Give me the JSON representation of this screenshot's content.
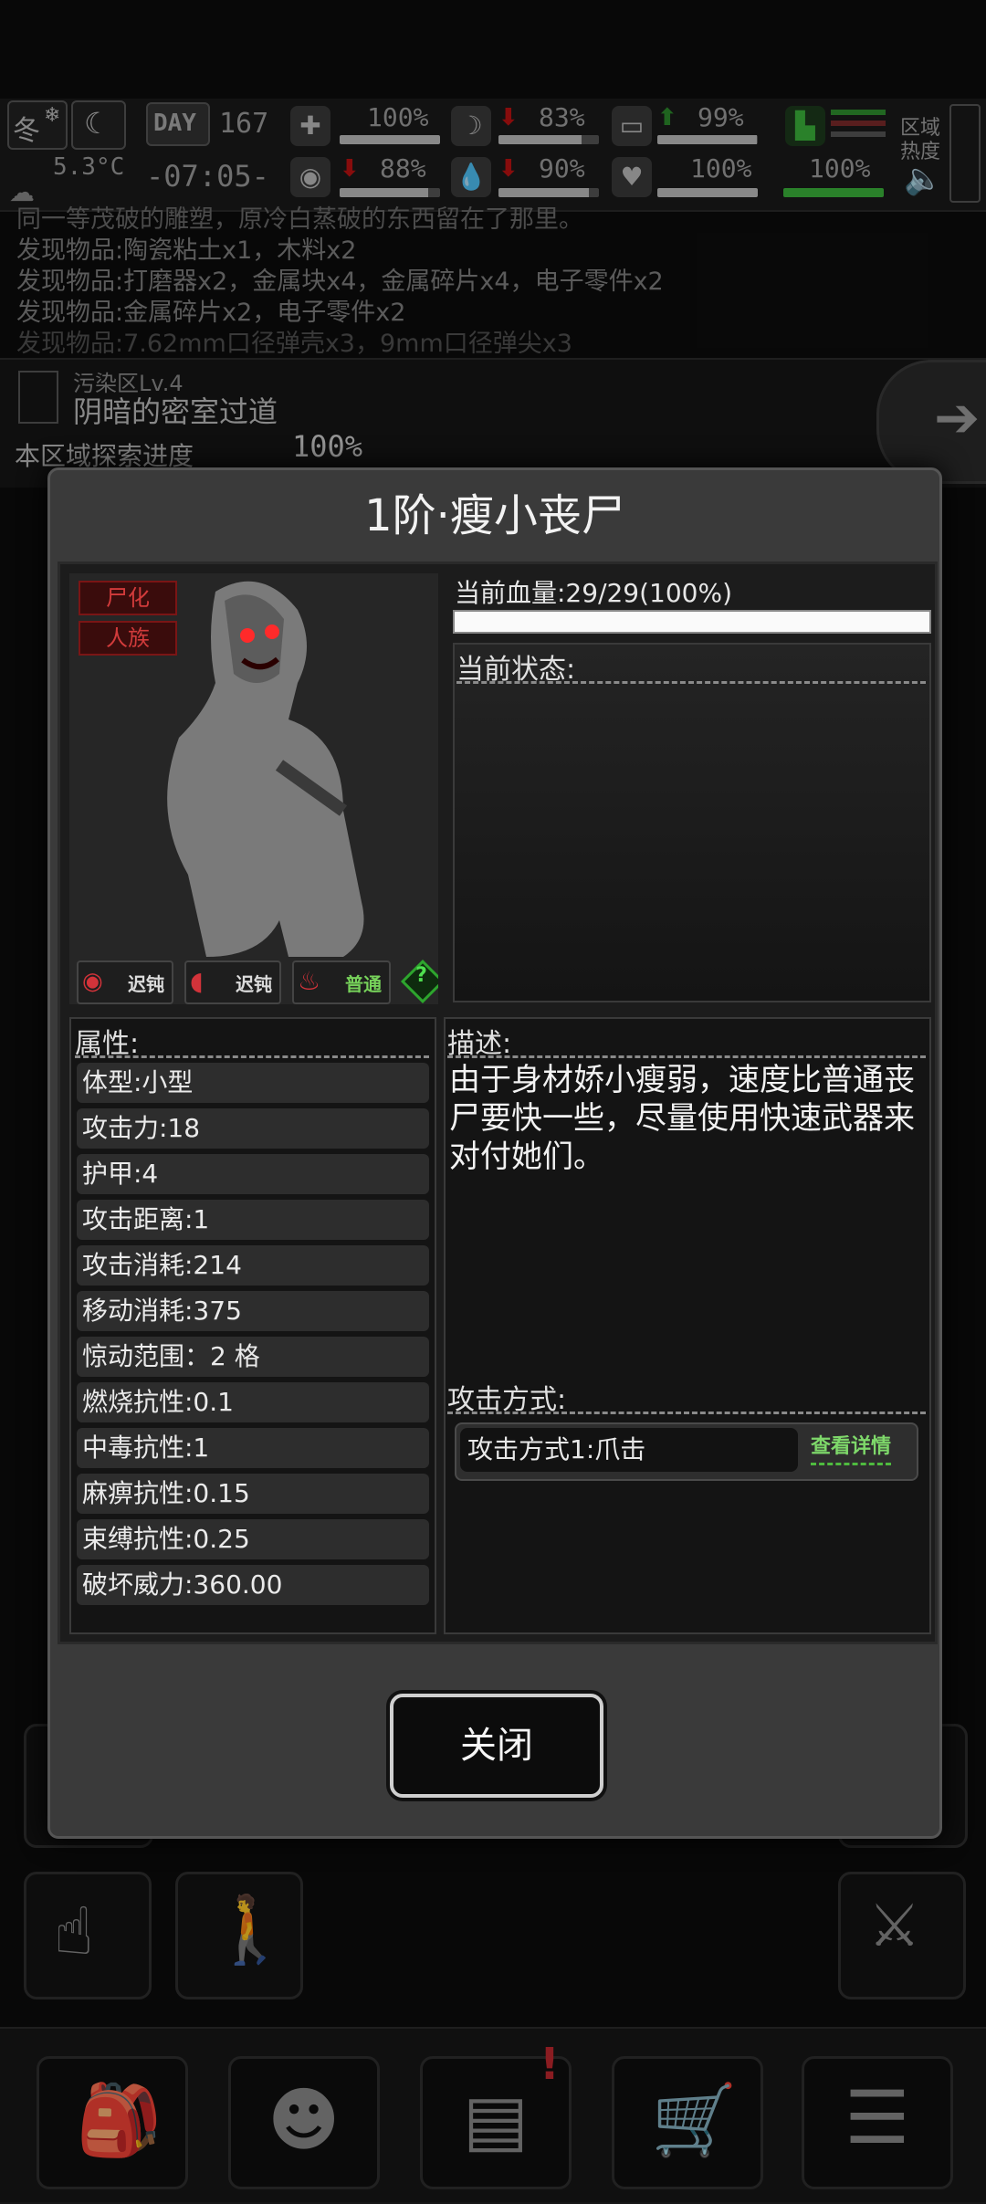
{
  "status": {
    "season": "冬",
    "temperature": "5.3°C",
    "day_label": "DAY",
    "day_count": "167",
    "time": "-07:05-",
    "health_pct": "100%",
    "sanity_pct": "88%",
    "hunger_pct": "83%",
    "thirst_pct": "90%",
    "energy_pct": "99%",
    "mood_pct": "100%",
    "stamina_pct": "100%",
    "region_label_line1": "区域",
    "region_label_line2": "热度",
    "bars": {
      "health": 1.0,
      "sanity": 0.88,
      "hunger": 0.83,
      "thirst": 0.9,
      "energy": 0.99,
      "mood": 1.0,
      "stamina": 1.0
    }
  },
  "log": [
    "同一等茂破的雕塑，原冷白蒸破的东西留在了那里。",
    "发现物品:陶瓷粘土x1，木料x2",
    "发现物品:打磨器x2，金属块x4，金属碎片x4，电子零件x2",
    "发现物品:金属碎片x2，电子零件x2",
    "发现物品:7.62mm口径弹壳x3，9mm口径弹尖x3"
  ],
  "zone": {
    "level": "污染区Lv.4",
    "name": "阴暗的密室过道",
    "explore_label": "本区域探索进度",
    "explore_pct": "100%"
  },
  "dialog": {
    "title": "1阶·瘦小丧尸",
    "tags": [
      "尸化",
      "人族"
    ],
    "senses": [
      {
        "name": "eye-icon",
        "label": "迟钝"
      },
      {
        "name": "ear-icon",
        "label": "迟钝"
      },
      {
        "name": "nose-icon",
        "label": "普通"
      }
    ],
    "help_symbol": "?",
    "hp_label": "当前血量:29/29(100%)",
    "hp_fraction": 1.0,
    "status_label": "当前状态:",
    "attr_label": "属性:",
    "attributes": [
      "体型:小型",
      "攻击力:18",
      "护甲:4",
      "攻击距离:1",
      "攻击消耗:214",
      "移动消耗:375",
      "惊动范围：2 格",
      "燃烧抗性:0.1",
      "中毒抗性:1",
      "麻痹抗性:0.15",
      "束缚抗性:0.25",
      "破坏威力:360.00"
    ],
    "desc_label": "描述:",
    "description": "由于身材娇小瘦弱，速度比普通丧尸要快一些，尽量使用快速武器来对付她们。",
    "attack_label": "攻击方式:",
    "attack_name": "攻击方式1:爪击",
    "attack_detail": "查看详情",
    "close_label": "关闭"
  }
}
